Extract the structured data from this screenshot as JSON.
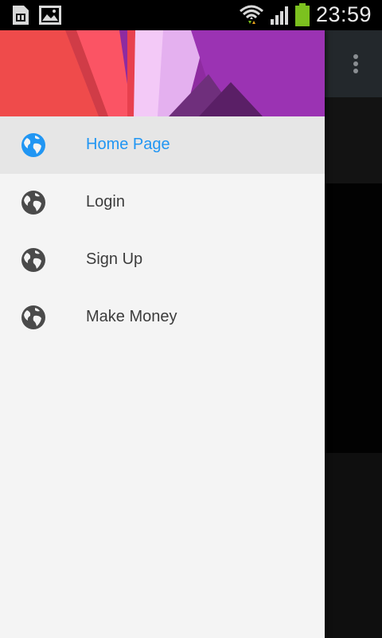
{
  "status_bar": {
    "time": "23:59",
    "icons": [
      "sim-card-icon",
      "image-icon",
      "wifi-icon",
      "signal-icon",
      "battery-icon"
    ],
    "battery_color": "#7cc11f"
  },
  "drawer": {
    "items": [
      {
        "label": "Home Page",
        "icon": "globe-icon",
        "active": true
      },
      {
        "label": "Login",
        "icon": "globe-icon",
        "active": false
      },
      {
        "label": "Sign Up",
        "icon": "globe-icon",
        "active": false
      },
      {
        "label": "Make Money",
        "icon": "globe-icon",
        "active": false
      }
    ]
  },
  "colors": {
    "accent": "#2196f3",
    "text": "#3c3c3c",
    "drawer_bg": "#f4f4f4",
    "active_bg": "#e6e6e6",
    "icon": "#4a4a4a"
  }
}
